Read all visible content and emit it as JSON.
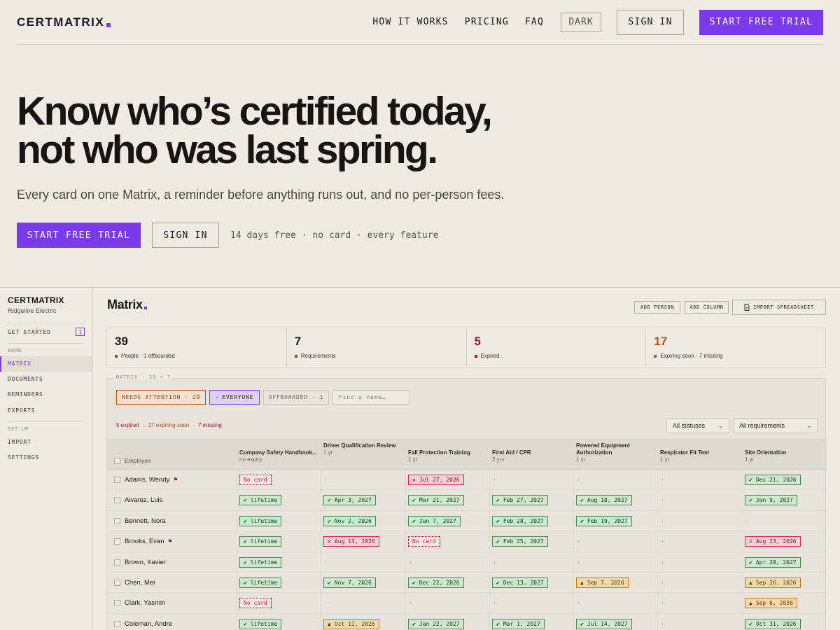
{
  "nav": {
    "logo": "CERTMATRIX",
    "links": [
      "HOW IT WORKS",
      "PRICING",
      "FAQ"
    ],
    "dark": "DARK",
    "signin": "SIGN IN",
    "trial": "START FREE TRIAL"
  },
  "hero": {
    "title_line1": "Know who’s certified today,",
    "title_line2": "not who was last spring.",
    "subtitle": "Every card on one Matrix, a reminder before anything runs out, and no per-person fees.",
    "cta_primary": "START FREE TRIAL",
    "cta_secondary": "SIGN IN",
    "note": "14 days free · no card · every feature"
  },
  "app": {
    "sidebar": {
      "brand": "CERTMATRIX",
      "org": "Ridgeline Electric",
      "get_started": "GET STARTED",
      "get_started_badge": "1",
      "section_work": "WORK",
      "items_work": [
        "MATRIX",
        "DOCUMENTS",
        "REMINDERS",
        "EXPORTS"
      ],
      "section_setup": "SET UP",
      "items_setup": [
        "IMPORT",
        "SETTINGS"
      ]
    },
    "title": "Matrix",
    "toolbar": {
      "add_person": "ADD PERSON",
      "add_column": "ADD COLUMN",
      "import": "IMPORT SPREADSHEET"
    },
    "stats": [
      {
        "value": "39",
        "label": "People · 1 offboarded",
        "color": "#7c3aed"
      },
      {
        "value": "7",
        "label": "Requirements",
        "color": "#7c3aed"
      },
      {
        "value": "5",
        "label": "Expired",
        "color": "#a3143a"
      },
      {
        "value": "17",
        "label": "Expiring soon · 7 missing",
        "color": "#b0521a"
      }
    ],
    "panel": {
      "heading": "MATRIX · 39 × 7",
      "filters": {
        "needs_attention": "NEEDS ATTENTION · 29",
        "everyone": "EVERYONE",
        "offboarded": "OFFBOARDED · 1",
        "search_placeholder": "Find a name…"
      },
      "summary": {
        "expired": "5 expired",
        "expiring": "17 expiring soon",
        "missing": "7 missing",
        "sep": "·"
      },
      "status_select": "All statuses",
      "req_select": "All requirements",
      "employee_header": "Employee",
      "columns": [
        {
          "name": "Company Safety Handbook...",
          "duration": "no expiry"
        },
        {
          "name": "Driver Qualification Review",
          "duration": "1 yr"
        },
        {
          "name": "Fall Protection Training",
          "duration": "1 yr"
        },
        {
          "name": "First Aid / CPR",
          "duration": "2 yrs"
        },
        {
          "name": "Powered Equipment Authorization",
          "duration": "1 yr"
        },
        {
          "name": "Respirator Fit Test",
          "duration": "1 yr"
        },
        {
          "name": "Site Orientation",
          "duration": "1 yr"
        }
      ],
      "rows": [
        {
          "name": "Adams, Wendy",
          "flag": true,
          "cells": [
            {
              "s": "nocard",
              "t": "No card"
            },
            {
              "s": "none",
              "t": "·"
            },
            {
              "s": "bad",
              "t": "Jul 27, 2026"
            },
            {
              "s": "none",
              "t": "·"
            },
            {
              "s": "none",
              "t": "·"
            },
            {
              "s": "none",
              "t": "·"
            },
            {
              "s": "ok",
              "t": "Dec 21, 2026"
            }
          ]
        },
        {
          "name": "Alvarez, Luis",
          "flag": false,
          "cells": [
            {
              "s": "ok",
              "t": "lifetime"
            },
            {
              "s": "ok",
              "t": "Apr 3, 2027"
            },
            {
              "s": "ok",
              "t": "Mar 21, 2027"
            },
            {
              "s": "ok",
              "t": "Feb 27, 2027"
            },
            {
              "s": "ok",
              "t": "Aug 18, 2027"
            },
            {
              "s": "none",
              "t": "·"
            },
            {
              "s": "ok",
              "t": "Jan 9, 2027"
            }
          ]
        },
        {
          "name": "Bennett, Nora",
          "flag": false,
          "cells": [
            {
              "s": "ok",
              "t": "lifetime"
            },
            {
              "s": "ok",
              "t": "Nov 2, 2026"
            },
            {
              "s": "ok",
              "t": "Jan 7, 2027"
            },
            {
              "s": "ok",
              "t": "Feb 28, 2027"
            },
            {
              "s": "ok",
              "t": "Feb 19, 2027"
            },
            {
              "s": "none",
              "t": "·"
            },
            {
              "s": "none",
              "t": "·"
            }
          ]
        },
        {
          "name": "Brooks, Evan",
          "flag": true,
          "cells": [
            {
              "s": "ok",
              "t": "lifetime"
            },
            {
              "s": "bad",
              "t": "Aug 13, 2026"
            },
            {
              "s": "nocard",
              "t": "No card"
            },
            {
              "s": "ok",
              "t": "Feb 25, 2027"
            },
            {
              "s": "none",
              "t": "·"
            },
            {
              "s": "none",
              "t": "·"
            },
            {
              "s": "bad",
              "t": "Aug 23, 2026"
            }
          ]
        },
        {
          "name": "Brown, Xavier",
          "flag": false,
          "cells": [
            {
              "s": "ok",
              "t": "lifetime"
            },
            {
              "s": "none",
              "t": "·"
            },
            {
              "s": "none",
              "t": "·"
            },
            {
              "s": "none",
              "t": "·"
            },
            {
              "s": "none",
              "t": "·"
            },
            {
              "s": "none",
              "t": "·"
            },
            {
              "s": "ok",
              "t": "Apr 28, 2027"
            }
          ]
        },
        {
          "name": "Chen, Mei",
          "flag": false,
          "cells": [
            {
              "s": "ok",
              "t": "lifetime"
            },
            {
              "s": "ok",
              "t": "Nov 7, 2026"
            },
            {
              "s": "ok",
              "t": "Dec 22, 2026"
            },
            {
              "s": "ok",
              "t": "Dec 13, 2027"
            },
            {
              "s": "warn",
              "t": "Sep 7, 2026"
            },
            {
              "s": "none",
              "t": "·"
            },
            {
              "s": "warn",
              "t": "Sep 26, 2026"
            }
          ]
        },
        {
          "name": "Clark, Yasmin",
          "flag": false,
          "cells": [
            {
              "s": "nocard",
              "t": "No card"
            },
            {
              "s": "none",
              "t": "·"
            },
            {
              "s": "none",
              "t": "·"
            },
            {
              "s": "none",
              "t": "·"
            },
            {
              "s": "none",
              "t": "·"
            },
            {
              "s": "none",
              "t": "·"
            },
            {
              "s": "warn",
              "t": "Sep 6, 2026"
            }
          ]
        },
        {
          "name": "Coleman, Andre",
          "flag": false,
          "cells": [
            {
              "s": "ok",
              "t": "lifetime"
            },
            {
              "s": "warn",
              "t": "Oct 11, 2026"
            },
            {
              "s": "ok",
              "t": "Jan 22, 2027"
            },
            {
              "s": "ok",
              "t": "Mar 1, 2027"
            },
            {
              "s": "ok",
              "t": "Jul 14, 2027"
            },
            {
              "s": "none",
              "t": "·"
            },
            {
              "s": "ok",
              "t": "Oct 31, 2026"
            }
          ]
        }
      ]
    }
  }
}
